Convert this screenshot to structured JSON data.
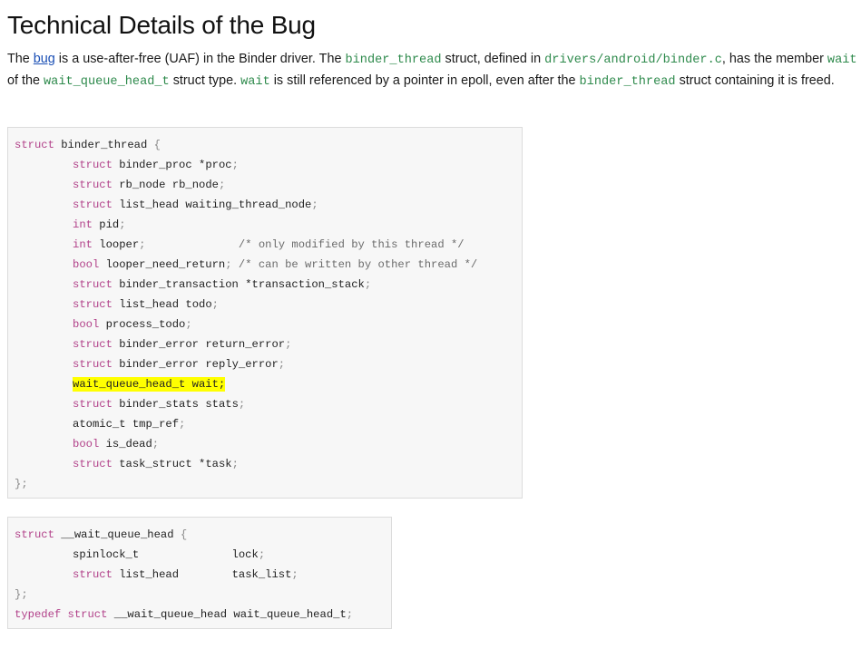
{
  "heading": "Technical Details of the Bug",
  "paragraph": {
    "p1": "The ",
    "link_bug": "bug",
    "p2": " is a use-after-free (UAF) in the Binder driver. The ",
    "c1": "binder_thread",
    "p3": " struct, defined in ",
    "c2": "drivers/android/binder.c",
    "p4": ", has the member ",
    "c3": "wait",
    "p5": " of the ",
    "c4": "wait_queue_head_t",
    "p6": " struct type. ",
    "c5": "wait",
    "p7": " is still referenced by a pointer in epoll, even after the ",
    "c6": "binder_thread",
    "p8": " struct containing it is freed."
  },
  "code1": {
    "open": "struct binder_thread {",
    "lines": [
      "struct binder_proc *proc;",
      "struct rb_node rb_node;",
      "struct list_head waiting_thread_node;",
      "int pid;",
      "int looper;              /* only modified by this thread */",
      "bool looper_need_return; /* can be written by other thread */",
      "struct binder_transaction *transaction_stack;",
      "struct list_head todo;",
      "bool process_todo;",
      "struct binder_error return_error;",
      "struct binder_error reply_error;",
      "wait_queue_head_t wait;",
      "struct binder_stats stats;",
      "atomic_t tmp_ref;",
      "bool is_dead;",
      "struct task_struct *task;"
    ],
    "close": "};",
    "highlighted_line": "wait_queue_head_t wait;"
  },
  "code2": {
    "open": "struct __wait_queue_head {",
    "lines": [
      "spinlock_t              lock;",
      "struct list_head        task_list;"
    ],
    "close": "};",
    "typedef": "typedef struct __wait_queue_head wait_queue_head_t;"
  },
  "colors": {
    "inline_code": "#2e8a4c",
    "link": "#1a4fb5",
    "highlight": "#ffff00",
    "code_bg": "#f7f7f7"
  }
}
